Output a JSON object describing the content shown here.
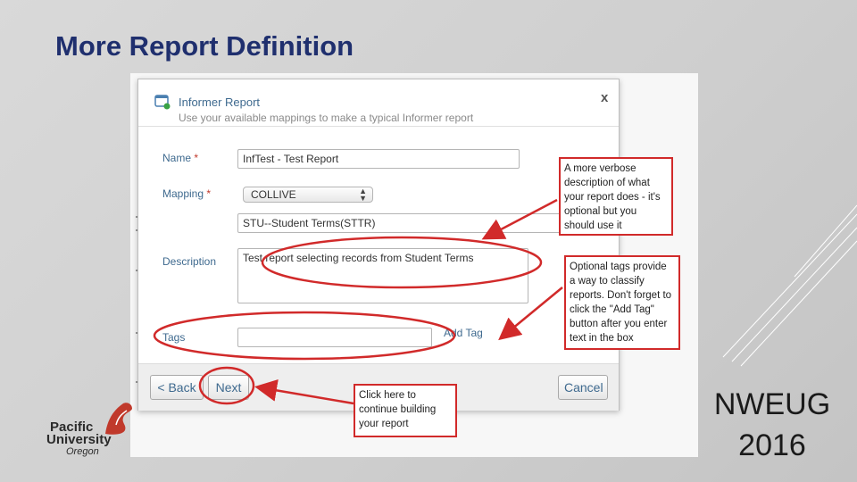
{
  "slide": {
    "title": "More Report Definition",
    "footer_line1": "NWEUG",
    "footer_line2": "2016"
  },
  "logo": {
    "text_line1": "Pacific",
    "text_line2": "University",
    "text_line3": "Oregon",
    "mark_color": "#c0392b"
  },
  "dialog": {
    "title": "Informer Report",
    "subtitle": "Use your available mappings to make a typical Informer report",
    "close_glyph": "x",
    "name_label": "Name",
    "name_value": "InfTest - Test Report",
    "mapping_label": "Mapping",
    "mapping_value": "COLLIVE",
    "mapping_sub_value": "STU--Student Terms(STTR)",
    "description_label": "Description",
    "description_value": "Test report selecting records from Student Terms",
    "tags_label": "Tags",
    "tags_value": "",
    "add_tag_label": "Add Tag",
    "required_marker": "*",
    "back_label": "< Back",
    "next_label": "Next",
    "cancel_label": "Cancel"
  },
  "callouts": {
    "description": "A more verbose description of what your report does - it's optional but you should use it",
    "tags": "Optional tags provide a way to classify reports. Don't forget to click the \"Add Tag\" button after you enter text in the box",
    "next": "Click here to continue building your report"
  },
  "colors": {
    "title": "#1f2f6e",
    "highlight": "#d12a2a",
    "dialog_label": "#3f6a8f"
  }
}
